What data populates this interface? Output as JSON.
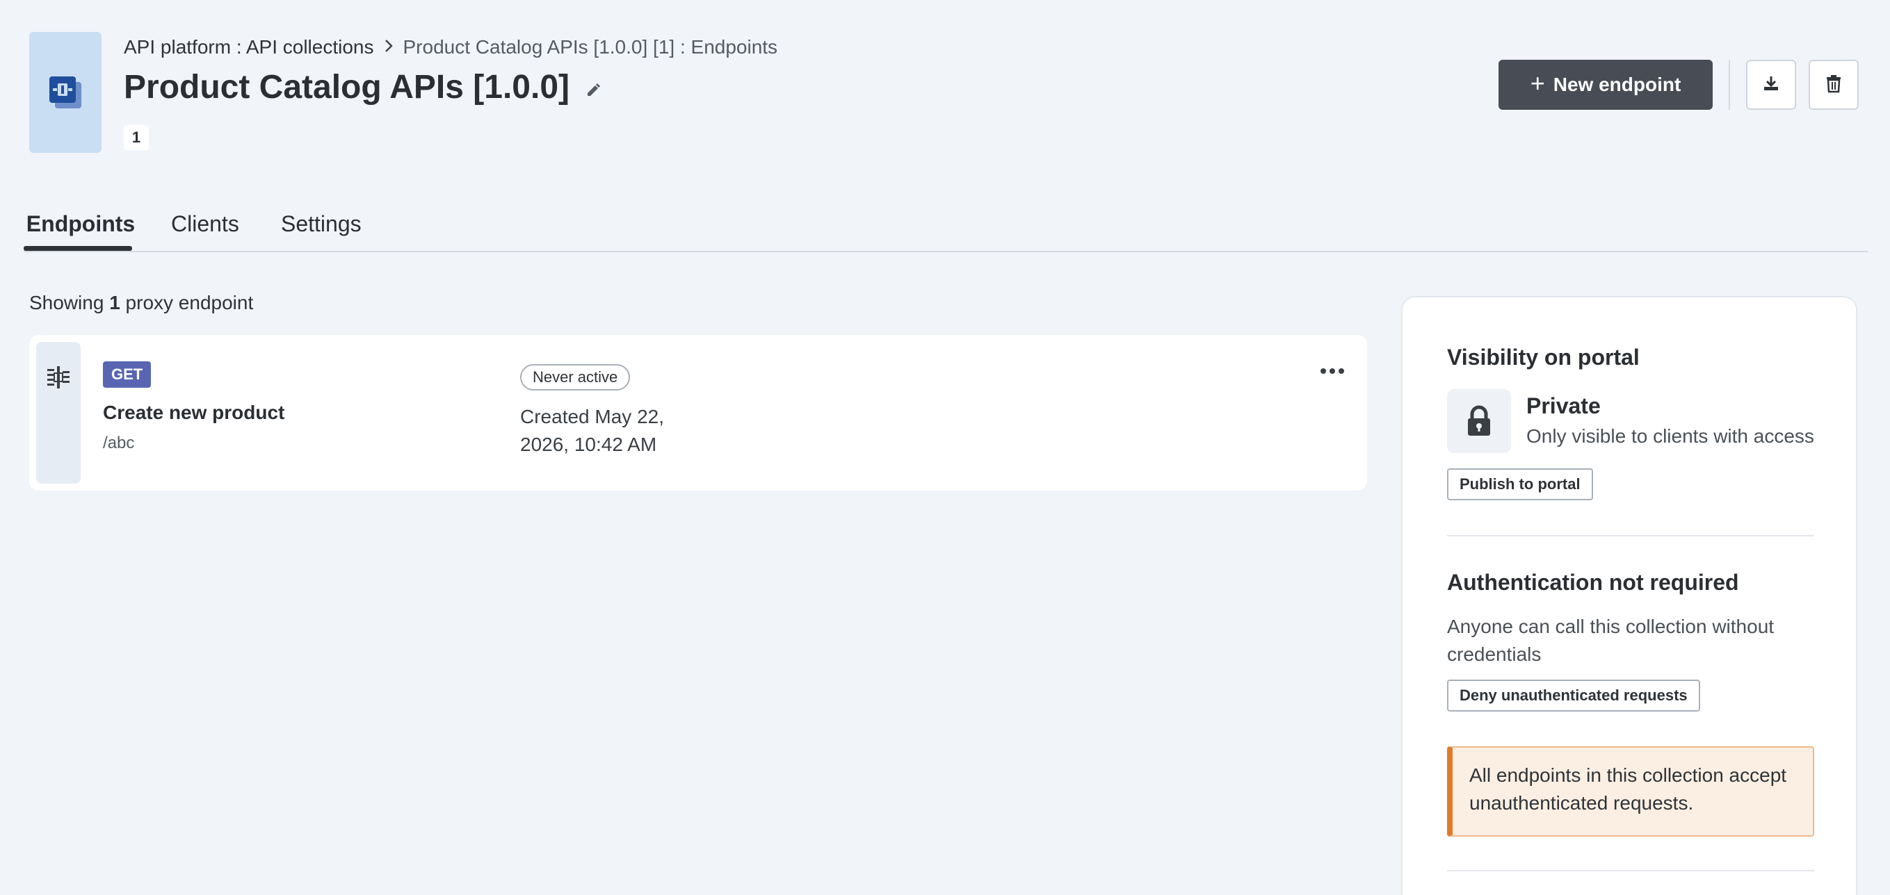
{
  "header": {
    "breadcrumb_root": "API platform : API collections",
    "breadcrumb_current": "Product Catalog APIs [1.0.0] [1] : Endpoints",
    "title": "Product Catalog APIs [1.0.0]",
    "version_badge": "1",
    "new_endpoint_label": "New endpoint"
  },
  "tabs": [
    {
      "label": "Endpoints",
      "active": true
    },
    {
      "label": "Clients",
      "active": false
    },
    {
      "label": "Settings",
      "active": false
    }
  ],
  "endpoints": {
    "showing_prefix": "Showing ",
    "showing_count": "1",
    "showing_suffix": " proxy endpoint",
    "items": [
      {
        "method": "GET",
        "name": "Create new product",
        "path": "/abc",
        "status": "Never active",
        "created": "Created May 22, 2026, 10:42 AM"
      }
    ]
  },
  "side_panel": {
    "visibility_title": "Visibility on portal",
    "visibility_state": "Private",
    "visibility_desc": "Only visible to clients with access",
    "publish_label": "Publish to portal",
    "auth_title": "Authentication not required",
    "auth_desc": "Anyone can call this collection without credentials",
    "deny_label": "Deny unauthenticated requests",
    "warning_text": "All endpoints in this collection accept unauthenticated requests."
  },
  "colors": {
    "background": "#f1f4f9",
    "primary_button": "#474c55",
    "method_get": "#5965b3",
    "warning_accent": "#e07a2a",
    "warning_bg": "#fbefe3",
    "collection_icon_bg": "#c9ddf3"
  },
  "icons": [
    "collection-icon",
    "chevron-right-icon",
    "pencil-icon",
    "plus-icon",
    "download-icon",
    "trash-icon",
    "endpoint-icon",
    "more-icon",
    "lock-icon"
  ]
}
